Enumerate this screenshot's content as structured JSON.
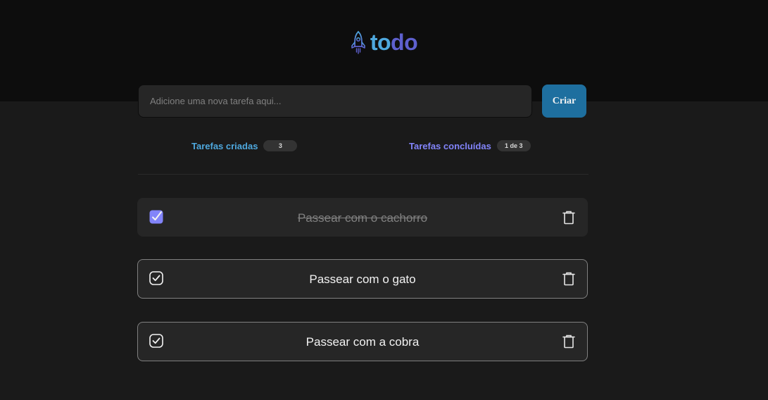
{
  "app": {
    "logo_part1": "to",
    "logo_part2": "do",
    "logo_icon": "rocket-icon"
  },
  "form": {
    "placeholder": "Adicione uma nova tarefa aqui...",
    "value": "",
    "create_label": "Criar"
  },
  "counters": {
    "created_label": "Tarefas criadas",
    "created_count": "3",
    "done_label": "Tarefas concluídas",
    "done_count": "1 de 3"
  },
  "tasks": [
    {
      "text": "Passear com o cachorro",
      "completed": true,
      "icon": "checkbox-checked-icon",
      "delete_icon": "trash-icon"
    },
    {
      "text": "Passear com o gato",
      "completed": false,
      "icon": "checkbox-icon",
      "delete_icon": "trash-icon"
    },
    {
      "text": "Passear com a cobra",
      "completed": false,
      "icon": "checkbox-icon",
      "delete_icon": "trash-icon"
    }
  ],
  "colors": {
    "blue": "#4ea8de",
    "purple": "#5e60ce",
    "purple_light": "#8284fa",
    "button": "#1e6f9f",
    "background": "#1a1a1a",
    "header": "#0d0d0d",
    "card": "#262626"
  }
}
